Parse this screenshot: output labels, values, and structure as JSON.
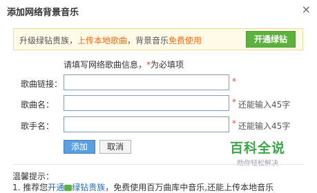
{
  "dialog": {
    "title": "添加网络背景音乐",
    "close_icon": "×"
  },
  "banner": {
    "text_prefix": "升级绿钻贵族，",
    "upload_text": "上传本地歌曲",
    "text_middle": "，背景音乐",
    "free_text": "免费使用",
    "button_label": "开通绿钻"
  },
  "form": {
    "hint_prefix": "请填写网络歌曲信息，",
    "hint_star": "*",
    "hint_suffix": "为必填项",
    "fields": [
      {
        "label": "歌曲链接：",
        "value": "",
        "required": "*",
        "counter": ""
      },
      {
        "label": "歌曲名：",
        "value": "",
        "required": "*",
        "counter": "还能输入45字"
      },
      {
        "label": "歌手名：",
        "value": "",
        "required": "*",
        "counter": "还能输入45字"
      }
    ],
    "add_label": "添加",
    "cancel_label": "取消"
  },
  "watermark": {
    "main": "百科全说",
    "sub": "助你轻松解决"
  },
  "tips": {
    "title": "温馨提示：",
    "line1_prefix": "1. 推荐您",
    "line1_link1": "开通",
    "line1_link2": "绿钻贵族",
    "line1_suffix": "，免费使用百万曲库中音乐,还能上传本地音乐"
  },
  "colors": {
    "accent_orange": "#f26a10",
    "vip_green": "#5cb23c",
    "required_red": "#e9453a",
    "primary_blue": "#5aa0e0"
  }
}
